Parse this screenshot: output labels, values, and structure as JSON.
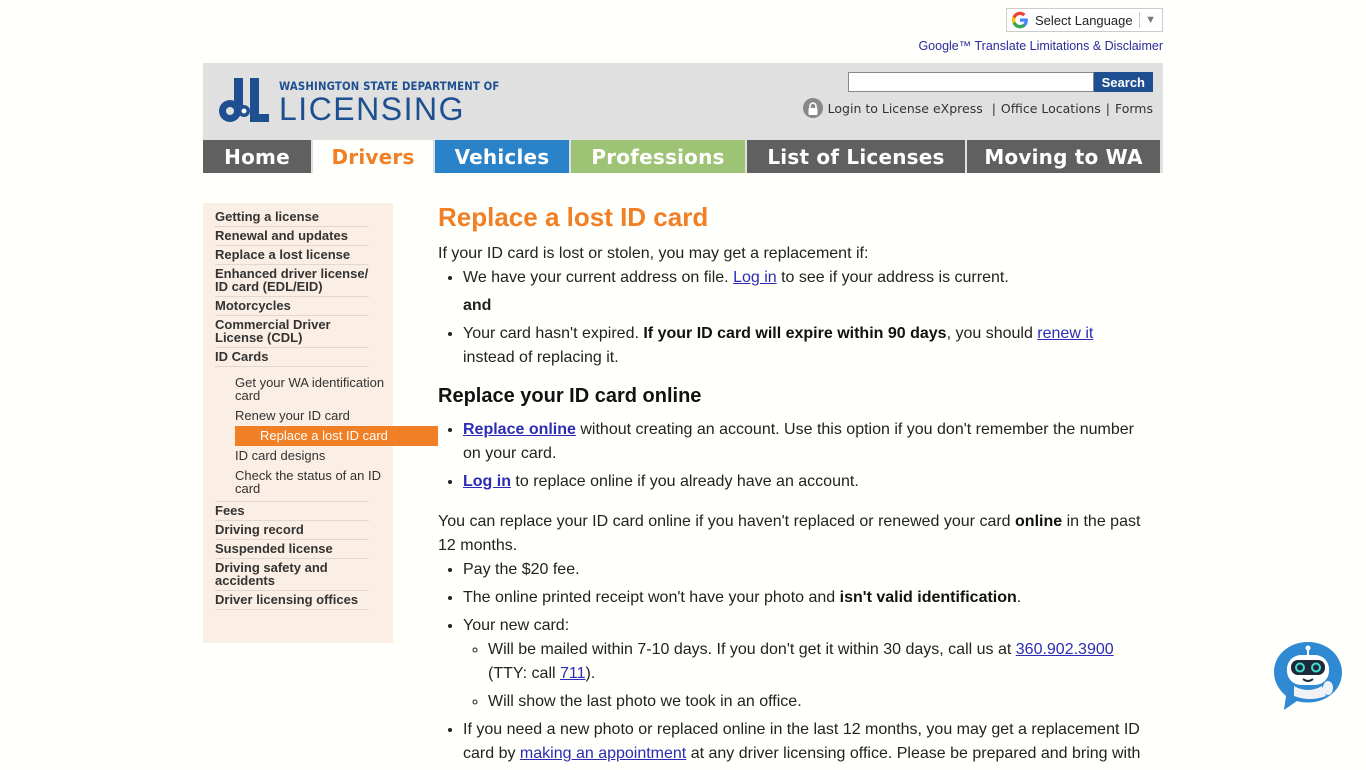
{
  "translate": {
    "label": "Select Language",
    "disclaimer": "Google™ Translate Limitations & Disclaimer"
  },
  "header": {
    "logo_small": "WASHINGTON STATE DEPARTMENT OF",
    "logo_big": "LICENSING",
    "search_placeholder": "",
    "search_button": "Search",
    "links": {
      "login": "Login to License eXpress",
      "offices": "Office Locations",
      "forms": "Forms"
    }
  },
  "nav": {
    "tabs": [
      {
        "label": "Home"
      },
      {
        "label": "Drivers"
      },
      {
        "label": "Vehicles"
      },
      {
        "label": "Professions"
      },
      {
        "label": "List of Licenses"
      },
      {
        "label": "Moving to WA"
      }
    ],
    "active": "Drivers",
    "colors": {
      "drivers": "#f07f25",
      "vehicles": "#2a82c9",
      "professions": "#9cc474",
      "dark": "#606060"
    }
  },
  "sidebar": {
    "items": [
      {
        "label": "Getting a license"
      },
      {
        "label": "Renewal and updates"
      },
      {
        "label": "Replace a lost license"
      },
      {
        "label": "Enhanced driver license/ ID card (EDL/EID)"
      },
      {
        "label": "Motorcycles"
      },
      {
        "label": "Commercial Driver License (CDL)"
      },
      {
        "label": "ID Cards"
      },
      {
        "label": "Fees"
      },
      {
        "label": "Driving record"
      },
      {
        "label": "Suspended license"
      },
      {
        "label": "Driving safety and accidents"
      },
      {
        "label": "Driver licensing offices"
      }
    ],
    "id_card_subitems": [
      {
        "label": "Get your WA identification card"
      },
      {
        "label": "Renew your ID card"
      },
      {
        "label": "Replace a lost ID card",
        "active": true
      },
      {
        "label": "ID card designs"
      },
      {
        "label": "Check the status of an ID card"
      }
    ]
  },
  "content": {
    "title": "Replace a lost ID card",
    "intro": "If your ID card is lost or stolen, you may get a replacement if:",
    "cond1_pre": "We have your current address on file. ",
    "cond1_link": "Log in",
    "cond1_post": " to see if your address is current.",
    "and": "and",
    "cond2_pre": "Your card hasn't expired. ",
    "cond2_bold": "If your ID card will expire within 90 days",
    "cond2_mid": ", you should ",
    "cond2_link": "renew it",
    "cond2_post": " instead of replacing it.",
    "h2_online": "Replace your ID card online",
    "opt1_link": "Replace online",
    "opt1_text": " without creating an account. Use this option if you don't remember the number on your card.",
    "opt2_link": "Log in",
    "opt2_text": " to replace online if you already have an account.",
    "para_pre": "You can replace your ID card online if you haven't replaced or renewed your card ",
    "para_bold": "online",
    "para_post": " in the past 12 months.",
    "fee": "Pay the $20 fee.",
    "receipt_pre": "The online printed receipt won't have your photo and ",
    "receipt_bold": "isn't valid identification",
    "receipt_post": ".",
    "newcard": "Your new card:",
    "mail_pre": "Will be mailed within 7-10 days. If you don't get it within 30 days, call us at ",
    "mail_phone": "360.902.3900",
    "mail_tty_pre": " (TTY: call ",
    "mail_tty": "711",
    "mail_tty_post": ").",
    "photo": "Will show the last photo we took in an office.",
    "office_pre": "If you need a new photo or replaced online in the last 12 months, you may get a replacement ID card by ",
    "office_link": "making an appointment",
    "office_post": " at any driver licensing office. Please be prepared and bring with"
  },
  "chatbot": {
    "icon": "robot-chat-icon"
  }
}
